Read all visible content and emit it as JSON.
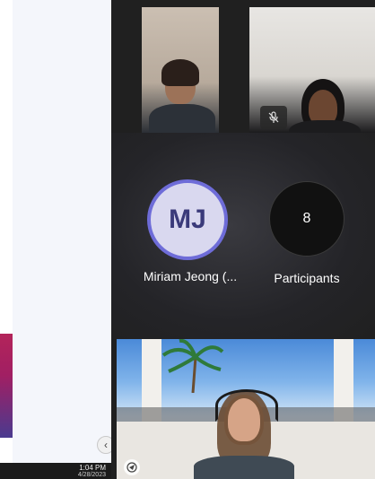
{
  "taskbar": {
    "time": "1:04 PM",
    "date": "4/28/2023"
  },
  "gallery": {
    "avatar_initials": "MJ",
    "avatar_name": "Miriam Jeong (...",
    "participants_count": "8",
    "participants_label": "Participants"
  },
  "icons": {
    "collapse": "chevron-left-icon",
    "mute": "mic-off-icon",
    "app": "teams-icon"
  },
  "colors": {
    "avatar_ring": "#6e6cd8",
    "avatar_fill": "#d9d8ef",
    "meeting_bg": "#202020"
  }
}
